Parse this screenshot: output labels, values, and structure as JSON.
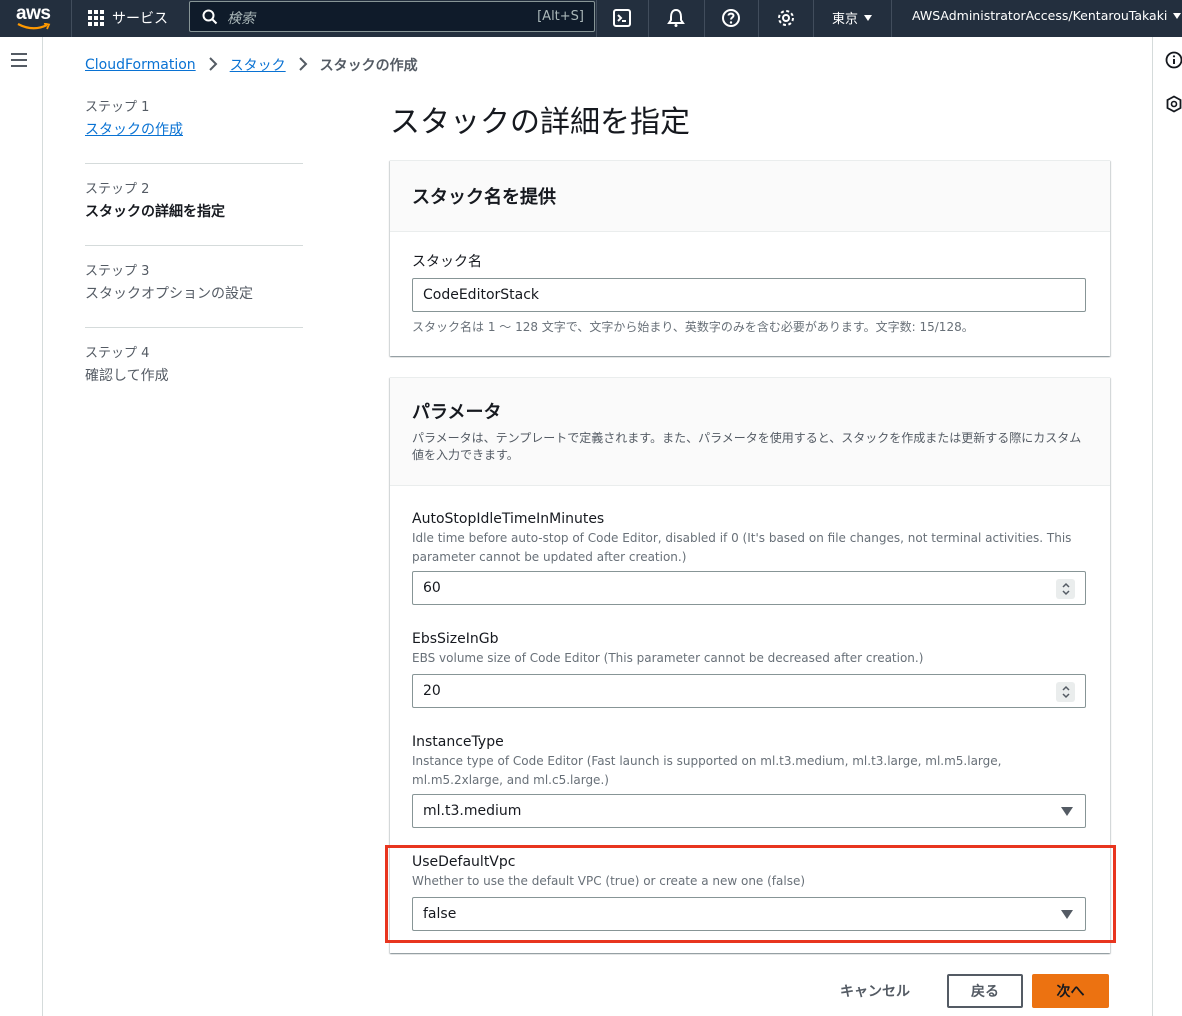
{
  "topnav": {
    "logo": "aws",
    "services_label": "サービス",
    "search_placeholder": "検索",
    "search_shortcut": "[Alt+S]",
    "region": "東京",
    "account": "AWSAdministratorAccess/KentarouTakaki",
    "icons": [
      "grid-icon",
      "search-icon",
      "cloudshell-icon",
      "bell-icon",
      "help-icon",
      "gear-icon"
    ]
  },
  "breadcrumb": {
    "items": [
      "CloudFormation",
      "スタック"
    ],
    "current": "スタックの作成"
  },
  "steps": [
    {
      "label": "ステップ 1",
      "title": "スタックの作成",
      "state": "link"
    },
    {
      "label": "ステップ 2",
      "title": "スタックの詳細を指定",
      "state": "active"
    },
    {
      "label": "ステップ 3",
      "title": "スタックオプションの設定",
      "state": "muted"
    },
    {
      "label": "ステップ 4",
      "title": "確認して作成",
      "state": "muted"
    }
  ],
  "page_title": "スタックの詳細を指定",
  "stack_name_panel": {
    "header": "スタック名を提供",
    "label": "スタック名",
    "value": "CodeEditorStack",
    "hint": "スタック名は 1 ～ 128 文字で、文字から始まり、英数字のみを含む必要があります。文字数: 15/128。"
  },
  "params_panel": {
    "header": "パラメータ",
    "description": "パラメータは、テンプレートで定義されます。また、パラメータを使用すると、スタックを作成または更新する際にカスタム値を入力できます。",
    "fields": [
      {
        "name": "AutoStopIdleTimeInMinutes",
        "description": "Idle time before auto-stop of Code Editor, disabled if 0 (It's based on file changes, not terminal activities. This parameter cannot be updated after creation.)",
        "value": "60",
        "kind": "number"
      },
      {
        "name": "EbsSizeInGb",
        "description": "EBS volume size of Code Editor (This parameter cannot be decreased after creation.)",
        "value": "20",
        "kind": "number"
      },
      {
        "name": "InstanceType",
        "description": "Instance type of Code Editor (Fast launch is supported on ml.t3.medium, ml.t3.large, ml.m5.large, ml.m5.2xlarge, and ml.c5.large.)",
        "value": "ml.t3.medium",
        "kind": "select"
      },
      {
        "name": "UseDefaultVpc",
        "description": "Whether to use the default VPC (true) or create a new one (false)",
        "value": "false",
        "kind": "select"
      }
    ]
  },
  "buttons": {
    "cancel": "キャンセル",
    "back": "戻る",
    "next": "次へ"
  },
  "colors": {
    "nav_bg": "#232f3e",
    "link": "#0972d3",
    "primary_button": "#ec7211",
    "highlight": "#e8351f"
  }
}
